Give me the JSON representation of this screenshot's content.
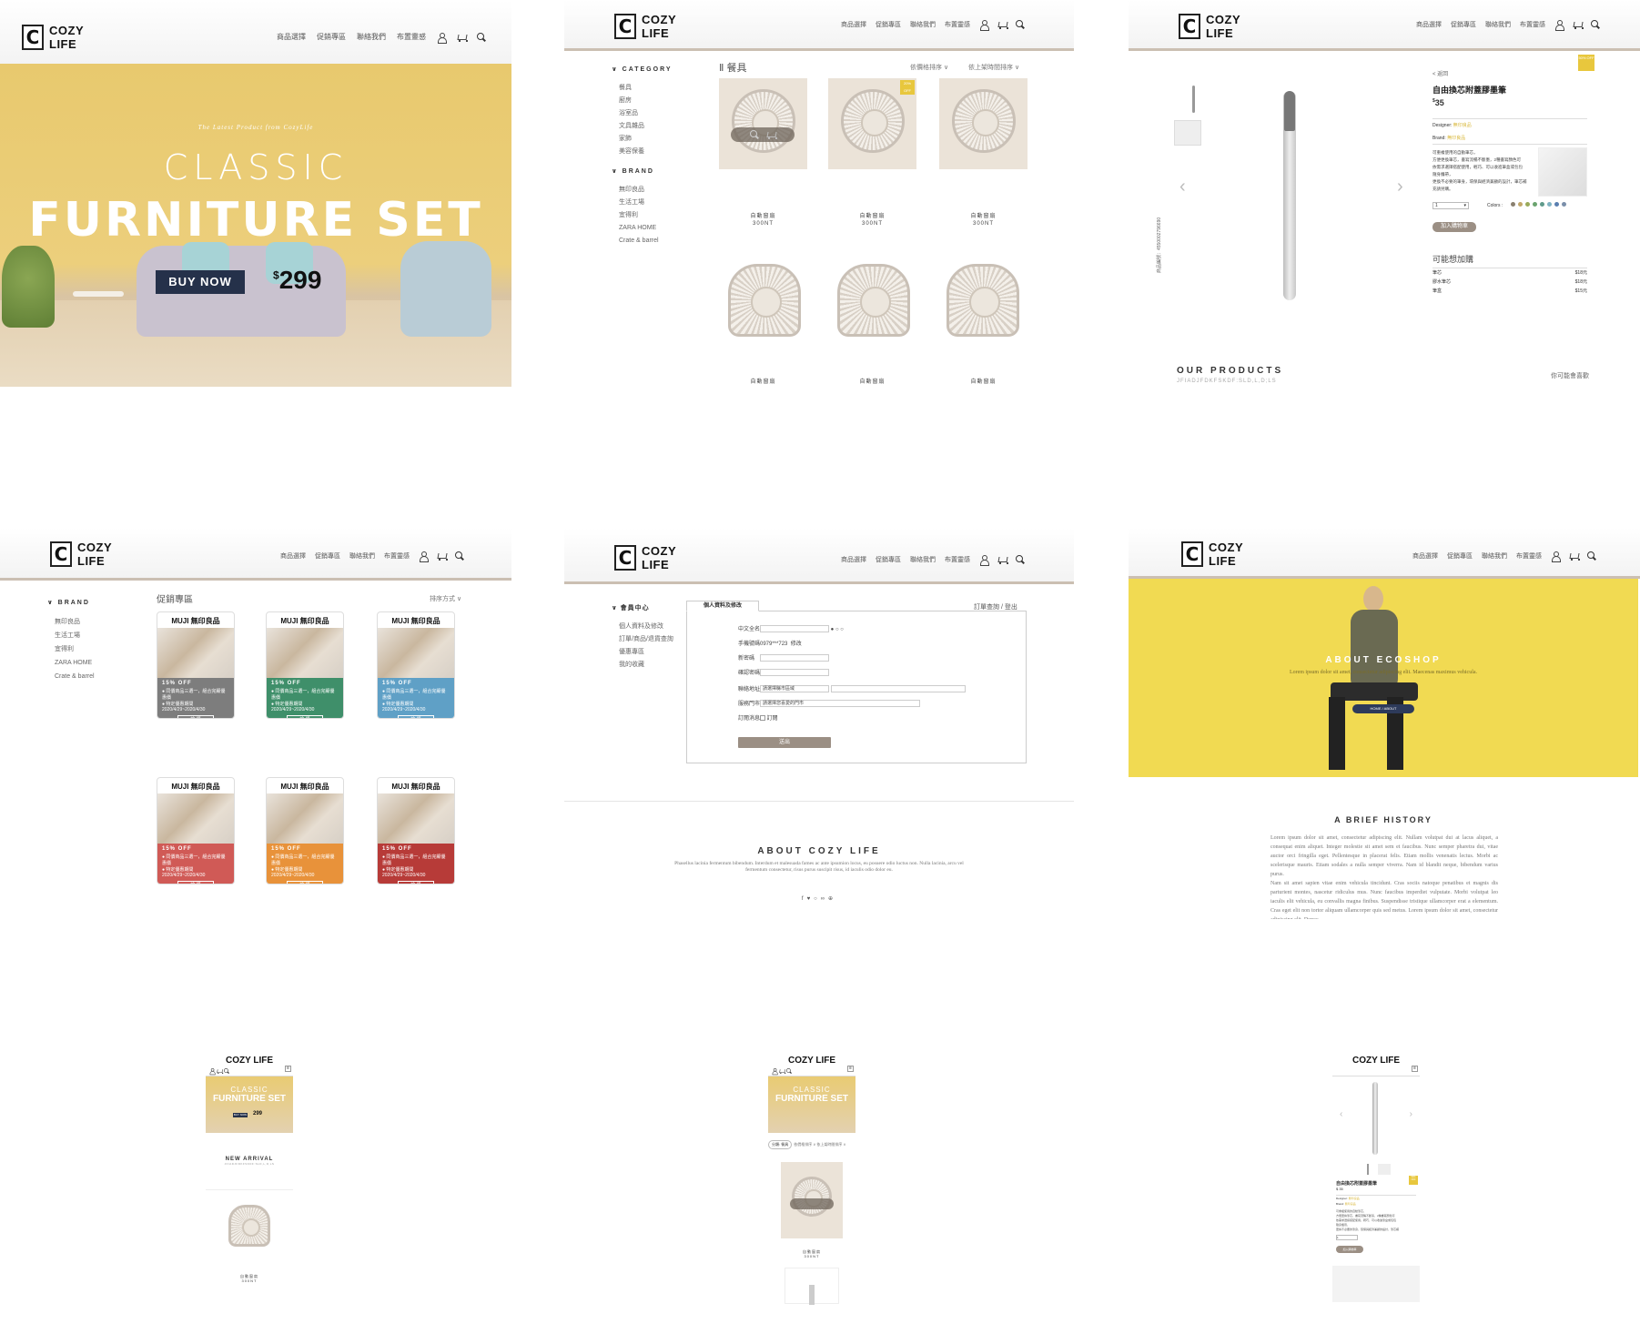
{
  "brand": {
    "line1": "COZY",
    "line2": "LIFE",
    "mark": "C",
    "mobile_name": "COZY LIFE"
  },
  "nav": {
    "items": [
      "商品選擇",
      "促銷專區",
      "聯絡我們",
      "布置靈感"
    ]
  },
  "home": {
    "tagline": "The Latest Product from CozyLife",
    "title_top": "CLASSIC",
    "title_main": "FURNITURE SET",
    "cta": "BUY NOW",
    "price_sym": "$",
    "price": "299"
  },
  "list": {
    "category_title": "CATEGORY",
    "categories": [
      "餐具",
      "廚房",
      "浴室品",
      "文具雜品",
      "家飾",
      "美容保養"
    ],
    "brand_title": "BRAND",
    "brands": [
      "無印良品",
      "生活工場",
      "宜得利",
      "ZARA HOME",
      "Crate & barrel"
    ],
    "heading": "餐具",
    "sort1": "依價格排序",
    "sort2": "依上架時間排序",
    "badge": "20% OFF",
    "product_name": "自動窗扇",
    "product_price": "300NT"
  },
  "detail": {
    "back": "< 返回",
    "title": "自由換芯附蓋膠墨筆",
    "price_sym": "$",
    "price": "35",
    "designer_label": "Designer",
    "designer_val": "無印良品",
    "brand_label": "Brand",
    "brand_val": "無印良品",
    "desc": [
      "可重複使用的自動筆芯，",
      "方便更換筆芯，書寫流暢不斷墨，2種書寫顏色可",
      "依需求選擇搭配使用，輕巧、可以收進筆盒或包包",
      "隨身攜帶，",
      "更換不必要的筆身，環保與經濟兼顧的設計，筆芯補",
      "充請另購。"
    ],
    "qty": "1",
    "colors_label": "Colors :",
    "colors": [
      "#8a8070",
      "#c2a76a",
      "#9aaa5a",
      "#6aa36e",
      "#5f9a8b",
      "#7fb2c2",
      "#5a7fb0",
      "#7a8faa"
    ],
    "add_cart": "加入購物車",
    "related_title": "可能想加購",
    "related": [
      {
        "name": "筆芯",
        "price": "$18元"
      },
      {
        "name": "膠水筆芯",
        "price": "$18元"
      },
      {
        "name": "筆盒",
        "price": "$15元"
      }
    ],
    "vertical": "商品編號：4550002796690",
    "our_products": "OUR PRODUCTS",
    "sub": "JFIADJFDKFSKDF:SLD,L,D;LS",
    "discount": "50% OFF",
    "more": "你可能會喜歡"
  },
  "promo": {
    "brand_title": "BRAND",
    "brands": [
      "無印良品",
      "生活工場",
      "宜得利",
      "ZARA HOME",
      "Crate & barrel"
    ],
    "heading": "促銷專區",
    "sort": "排序方式",
    "muji": "MUJI 無印良品",
    "discount": "15% OFF",
    "line1": "● 同價商品三選一，組合完顯優惠價",
    "line2": "● 特定優惠期間2020/4/29~2020/4/30",
    "btn": "搶 購",
    "colors": [
      "#7d7d7d",
      "#3f8f6a",
      "#5fa0c6",
      "#d05a56",
      "#e8923a",
      "#b73b38"
    ]
  },
  "member": {
    "side_title": "會員中心",
    "side_items": [
      "個人資料及修改",
      "訂單/商品/退貨查詢",
      "優惠專區",
      "我的收藏"
    ],
    "tab": "個人資料及修改",
    "right_link": "訂單查詢 / 登出",
    "fields": [
      "中文全名",
      "手機號碼",
      "新密碼",
      "確認密碼",
      "聯絡地址",
      "服務門市",
      "訂閱消息"
    ],
    "phone": "0979***723",
    "phone_edit": "修改",
    "address_ph": "請選擇縣市區域",
    "store_ph": "請選擇您喜愛的門市",
    "subscribe": "訂閱",
    "submit": "送出",
    "about_title": "ABOUT COZY LIFE",
    "about_text": "Phasellus lacinia fermentum bibendum. Interdum et malesuada fames ac ante ipsumion locus, eu posuere odio luctus non. Nulla lacinia, arcu vel fermentum consectetur, risus purus suscipit risus, id iaculis odio dolor eu."
  },
  "about": {
    "title": "ABOUT ECOSHOP",
    "subtitle": "Lorem ipsum dolor sit amet, consectetur adipiscing elit. Maecenas maximus vehicula.",
    "crumb1": "HOME",
    "crumb2": "ABOUT",
    "history_title": "A BRIEF HISTORY",
    "para1": "Lorem ipsum dolor sit amet, consectetur adipiscing elit. Nullam volutpat dui at lacus aliquet, a consequat enim aliquet. Integer molestie sit amet sem et faucibus. Nunc semper pharetra dui, vitae auctor orci fringilla eget. Pellentesque in placerat felis. Etiam mollis venenatis lectus. Morbi ac scelerisque mauris. Etiam sodales a nulla semper viverra. Nam id blandit neque, bibendum varius purus.",
    "para2": "Nam sit amet sapien vitae enim vehicula tincidunt. Cras sociis natoque penatibus et magnis dis parturient montes, nascetur ridiculus mus. Nunc faucibus imperdiet vulputate. Morbi volutpat leo iaculis elit vehicula, eu convallis magna finibus. Suspendisse tristique ullamcorper erat a elementum. Cras eget elit non tortor aliquam ullamcorper quis sed metus. Lorem ipsum dolor sit amet, consectetur adipiscing elit. Donec"
  },
  "mobile": {
    "new_arrival": "NEW ARRIVAL",
    "na_sub": "JFIADJFDKFSKDF:SLD,L,D;LS",
    "filter": "分類: 餐具",
    "sort": "依價格排序 ∨ 依上架時間排序 ∨",
    "pname": "自動窗扇",
    "pprice": "300NT",
    "dtitle": "自由換芯附蓋膠墨筆",
    "dprice": "$ 35",
    "add": "加入購物車"
  }
}
